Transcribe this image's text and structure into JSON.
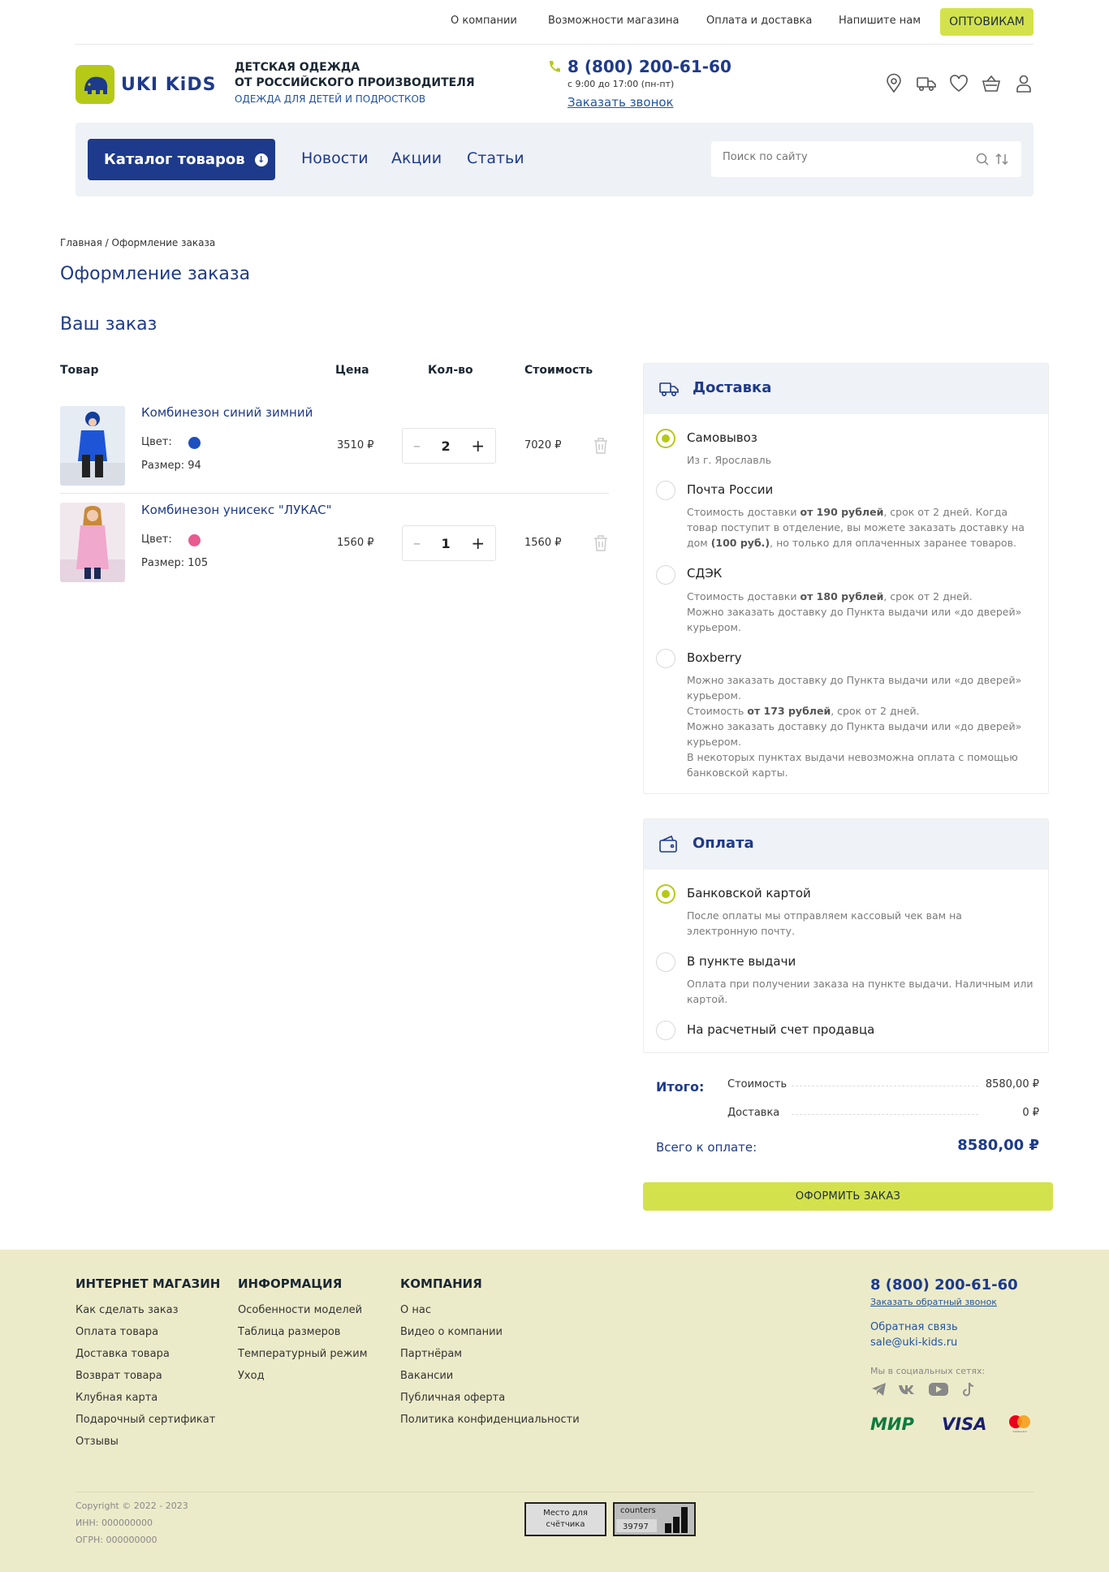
{
  "topnav": {
    "items": [
      "О компании",
      "Возможности магазина",
      "Оплата и доставка",
      "Напишите нам"
    ],
    "wholesale": "ОПТОВИКАМ"
  },
  "header": {
    "logo_text": "UKI KiDS",
    "tagline_1": "ДЕТСКАЯ ОДЕЖДА",
    "tagline_2": "ОТ РОССИЙСКОГО ПРОИЗВОДИТЕЛЯ",
    "tagline_3": "ОДЕЖДА ДЛЯ ДЕТЕЙ И ПОДРОСТКОВ",
    "phone": "8 (800) 200-61-60",
    "hours": "с 9:00 до 17:00 (пн-пт)",
    "callback": "Заказать звонок",
    "icons": [
      "location-icon",
      "truck-icon",
      "heart-icon",
      "basket-icon",
      "user-icon"
    ]
  },
  "menu": {
    "catalog": "Каталог товаров",
    "links": [
      "Новости",
      "Акции",
      "Статьи"
    ],
    "search_placeholder": "Поиск по сайту"
  },
  "breadcrumb": "Главная / Оформление заказа",
  "page_title": "Оформление заказа",
  "order_title": "Ваш заказ",
  "table": {
    "headers": [
      "Товар",
      "Цена",
      "Кол-во",
      "Стоимость"
    ],
    "color_label": "Цвет:",
    "rows": [
      {
        "name": "Комбинезон синий зимний",
        "color": "#1e4fc2",
        "size": "Размер: 94",
        "price": "3510 ₽",
        "qty": "2",
        "total": "7020 ₽"
      },
      {
        "name": "Комбинезон унисекс \"ЛУКАС\"",
        "color": "#e85a90",
        "size": "Размер: 105",
        "price": "1560 ₽",
        "qty": "1",
        "total": "1560 ₽"
      }
    ]
  },
  "delivery": {
    "title": "Доставка",
    "options": [
      {
        "label": "Самовывоз",
        "selected": true,
        "desc": "Из г. Ярославль"
      },
      {
        "label": "Почта России",
        "selected": false,
        "desc_html": "Стоимость доставки <b>от 190 рублей</b>, срок от 2 дней. Когда товар поступит в отделение, вы можете заказать доставку на дом <b>(100 руб.)</b>, но только для оплаченных заранее товаров."
      },
      {
        "label": "СДЭК",
        "selected": false,
        "desc_html": "Стоимость доставки <b>от 180 рублей</b>, срок от 2 дней.<br>Можно заказать доставку до Пункта выдачи или «до дверей» курьером."
      },
      {
        "label": "Boxberry",
        "selected": false,
        "desc_html": "Можно заказать доставку до Пункта выдачи или «до дверей» курьером.<br>Стоимость <b>от 173 рублей</b>, срок от 2 дней.<br>Можно заказать доставку до Пункта выдачи или «до дверей» курьером.<br>В некоторых пунктах выдачи невозможна оплата с помощью банковской карты."
      }
    ]
  },
  "payment": {
    "title": "Оплата",
    "options": [
      {
        "label": "Банковской картой",
        "selected": true,
        "desc": "После оплаты мы отправляем кассовый чек вам на электронную почту."
      },
      {
        "label": "В пункте выдачи",
        "selected": false,
        "desc": "Оплата при получении заказа на пункте выдачи. Наличным или картой."
      },
      {
        "label": "На расчетный счет продавца",
        "selected": false
      }
    ]
  },
  "totals": {
    "heading": "Итого:",
    "cost_label": "Стоимость",
    "cost_value": "8580,00 ₽",
    "delivery_label": "Доставка",
    "delivery_value": "0 ₽",
    "total_label": "Всего к оплате:",
    "total_value": "8580,00 ₽",
    "submit": "ОФОРМИТЬ ЗАКАЗ"
  },
  "footer": {
    "col1": {
      "title": "ИНТЕРНЕТ МАГАЗИН",
      "links": [
        "Как сделать заказ",
        "Оплата товара",
        "Доставка товара",
        "Возврат товара",
        "Клубная карта",
        "Подарочный сертификат",
        "Отзывы"
      ]
    },
    "col2": {
      "title": "ИНФОРМАЦИЯ",
      "links": [
        "Особенности моделей",
        "Таблица размеров",
        "Температурный режим",
        "Уход"
      ]
    },
    "col3": {
      "title": "КОМПАНИЯ",
      "links": [
        "О нас",
        "Видео о компании",
        "Партнёрам",
        "Вакансии",
        "Публичная оферта",
        "Политика конфиденциальности"
      ]
    },
    "phone": "8 (800) 200-61-60",
    "callback": "Заказать обратный звонок",
    "feedback": "Обратная связь",
    "email": "sale@uki-kids.ru",
    "social_label": "Мы в социальных сетях:",
    "social": [
      "telegram-icon",
      "vk-icon",
      "youtube-icon",
      "tiktok-icon"
    ],
    "payments": [
      "МИР",
      "VISA",
      "mastercard"
    ],
    "copyright": "Copyright © 2022 - 2023",
    "inn": "ИНН: 000000000",
    "ogrn": "ОГРН: 000000000",
    "counter_placeholder": "Место для счётчика",
    "counter_label": "counters",
    "counter_value": "39797"
  },
  "colors": {
    "brand_blue": "#1e3a8a",
    "accent_green": "#d3e24c",
    "footer_bg": "#ecebc9"
  }
}
